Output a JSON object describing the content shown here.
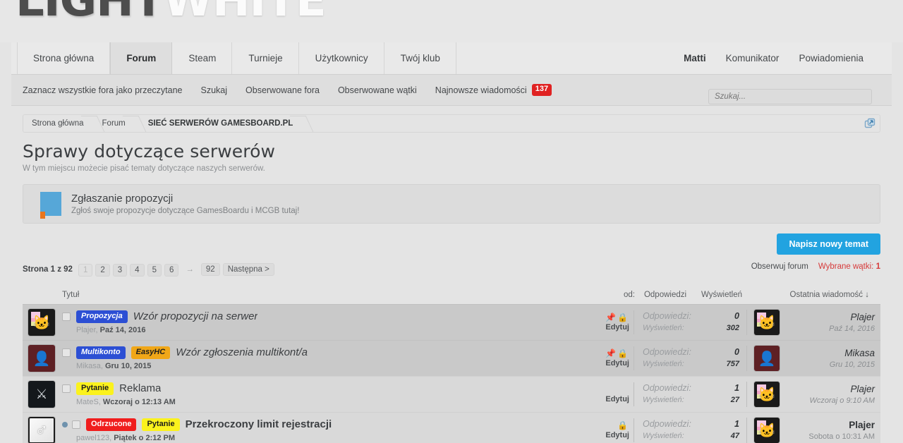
{
  "logo": {
    "part1": "LIGHT",
    "part2": "WHITE"
  },
  "nav": {
    "tabs": [
      {
        "label": "Strona główna",
        "active": false
      },
      {
        "label": "Forum",
        "active": true
      },
      {
        "label": "Steam",
        "active": false
      },
      {
        "label": "Turnieje",
        "active": false
      },
      {
        "label": "Użytkownicy",
        "active": false
      },
      {
        "label": "Twój klub",
        "active": false
      }
    ],
    "right": [
      {
        "label": "Matti",
        "name": "nav-user"
      },
      {
        "label": "Komunikator",
        "name": "nav-messenger"
      },
      {
        "label": "Powiadomienia",
        "name": "nav-notifications"
      }
    ]
  },
  "subnav": {
    "items": [
      "Zaznacz wszystkie fora jako przeczytane",
      "Szukaj",
      "Obserwowane fora",
      "Obserwowane wątki",
      "Najnowsze wiadomości"
    ],
    "new_messages_count": "137",
    "search_placeholder": "Szukaj..."
  },
  "breadcrumb": [
    {
      "label": "Strona główna"
    },
    {
      "label": "Forum"
    },
    {
      "label": "SIEĆ SERWERÓW GAMESBOARD.PL"
    }
  ],
  "page": {
    "title": "Sprawy dotyczące serwerów",
    "description": "W tym miejscu możecie pisać tematy dotyczące naszych serwerów."
  },
  "subforum": {
    "name": "Zgłaszanie propozycji",
    "description": "Zgłoś swoje propozycje dotyczące GamesBoardu i MCGB tutaj!"
  },
  "actions": {
    "new_thread": "Napisz nowy temat",
    "watch_forum": "Obserwuj forum",
    "selected_label": "Wybrane wątki:",
    "selected_count": "1"
  },
  "pager": {
    "label": "Strona 1 z 92",
    "pages": [
      "1",
      "2",
      "3",
      "4",
      "5",
      "6"
    ],
    "ellipsis": "→",
    "last": "92",
    "next": "Następna >"
  },
  "columns": {
    "title": "Tytuł",
    "from": "od:",
    "replies": "Odpowiedzi",
    "views": "Wyświetleń",
    "last_message": "Ostatnia wiadomość ↓"
  },
  "labels": {
    "replies": "Odpowiedzi:",
    "views": "Wyświetleń:",
    "edit": "Edytuj"
  },
  "threads": [
    {
      "sticky": true,
      "unread": false,
      "dot": false,
      "avatar": "nyan-cat",
      "prefixes": [
        {
          "text": "Propozycja",
          "style": "pf-blue"
        }
      ],
      "title": "Wzór propozycji na serwer",
      "title_style": "ital",
      "author": "Plajer,",
      "date": "Paź 14, 2016",
      "pinned": true,
      "locked": true,
      "replies": "0",
      "views": "302",
      "last_avatar": "nyan-cat",
      "last_user": "Plajer",
      "last_date": "Paź 14, 2016"
    },
    {
      "sticky": true,
      "unread": false,
      "dot": false,
      "avatar": "anime-red",
      "prefixes": [
        {
          "text": "Multikonto",
          "style": "pf-blue"
        },
        {
          "text": "EasyHC",
          "style": "pf-orange"
        }
      ],
      "title": "Wzór zgłoszenia multikont/a",
      "title_style": "ital",
      "author": "Mikasa,",
      "date": "Gru 10, 2015",
      "pinned": true,
      "locked": true,
      "replies": "0",
      "views": "757",
      "last_avatar": "anime-red",
      "last_user": "Mikasa",
      "last_date": "Gru 10, 2015"
    },
    {
      "sticky": false,
      "unread": false,
      "dot": false,
      "avatar": "crossed-swords",
      "prefixes": [
        {
          "text": "Pytanie",
          "style": "pf-yellow"
        }
      ],
      "title": "Reklama",
      "title_style": "",
      "author": "MateS,",
      "date": "Wczoraj o 12:13 AM",
      "pinned": false,
      "locked": false,
      "replies": "1",
      "views": "27",
      "last_avatar": "nyan-cat",
      "last_user": "Plajer",
      "last_date": "Wczoraj o 9:10 AM"
    },
    {
      "sticky": false,
      "unread": true,
      "dot": true,
      "avatar": "mars-symbol",
      "prefixes": [
        {
          "text": "Odrzucone",
          "style": "pf-red"
        },
        {
          "text": "Pytanie",
          "style": "pf-yellow"
        }
      ],
      "title": "Przekroczony limit rejestracji",
      "title_style": "bold",
      "author": "pawel123,",
      "date": "Piątek o 2:12 PM",
      "pinned": false,
      "locked": true,
      "replies": "1",
      "views": "47",
      "last_avatar": "nyan-cat",
      "last_user": "Plajer",
      "last_date": "Sobota o 10:31 AM"
    }
  ],
  "icons": {
    "pin": "📌",
    "lock": "🔒",
    "popup": "popup-icon"
  }
}
